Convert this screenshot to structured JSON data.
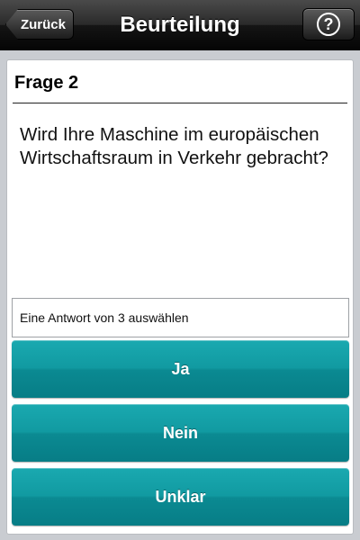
{
  "nav": {
    "back_label": "Zurück",
    "title": "Beurteilung",
    "help_glyph": "?"
  },
  "question": {
    "number": "Frage 2",
    "text": "Wird Ihre Maschine im europäischen Wirtschaftsraum in Verkehr gebracht?"
  },
  "hint": "Eine Antwort von 3 auswählen",
  "answers": [
    {
      "label": "Ja"
    },
    {
      "label": "Nein"
    },
    {
      "label": "Unklar"
    }
  ],
  "colors": {
    "accent": "#0f939b",
    "navbar": "#1a1a1a"
  },
  "icons": {
    "help": "help-icon"
  }
}
